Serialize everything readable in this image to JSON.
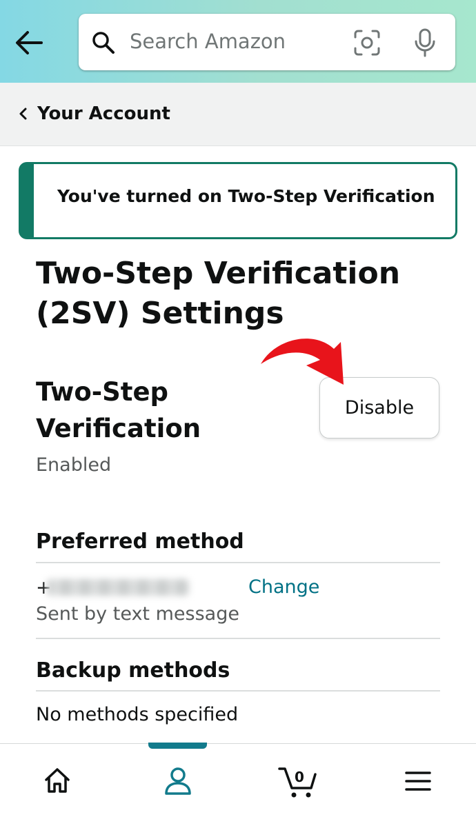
{
  "search": {
    "placeholder": "Search Amazon"
  },
  "breadcrumb": {
    "label": "Your Account"
  },
  "alert": {
    "message": "You've turned on Two-Step Verification"
  },
  "page": {
    "title": "Two-Step Verification (2SV) Settings"
  },
  "feature": {
    "title": "Two-Step Verification",
    "status": "Enabled",
    "disable_label": "Disable"
  },
  "preferred": {
    "heading": "Preferred method",
    "phone_prefix": "+",
    "change_label": "Change",
    "delivery": "Sent by text message"
  },
  "backup": {
    "heading": "Backup methods",
    "empty_text": "No methods specified"
  },
  "nav": {
    "cart_count": "0",
    "items": [
      "home-icon",
      "account-icon",
      "cart-icon",
      "menu-icon"
    ],
    "active": "account-icon"
  },
  "colors": {
    "header_gradient_start": "#84d8e4",
    "header_gradient_end": "#a6e7ce",
    "alert_accent": "#127a65",
    "link": "#007185",
    "active_nav": "#127b8c",
    "annotation_arrow": "#e8141b"
  }
}
